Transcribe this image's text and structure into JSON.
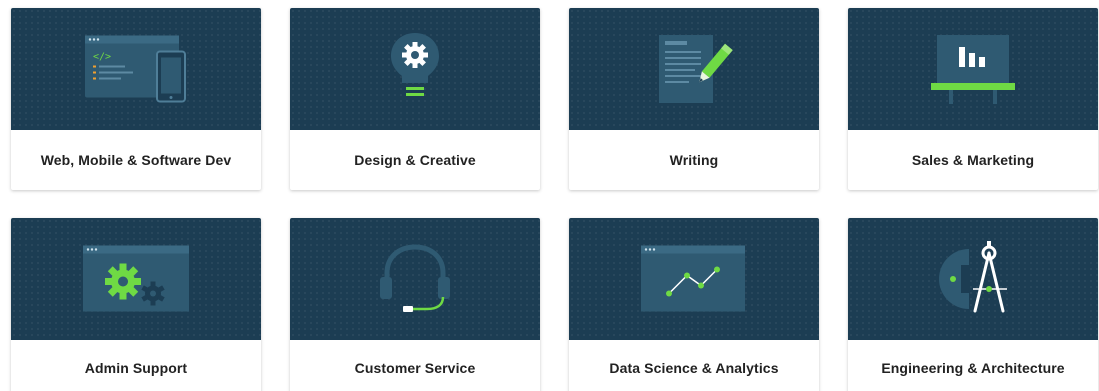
{
  "colors": {
    "hero_background": "#1c3d53",
    "icon_panel": "#2f5a72",
    "accent_green": "#6fda44"
  },
  "categories": [
    {
      "label": "Web, Mobile & Software Dev",
      "icon": "code-devices-icon"
    },
    {
      "label": "Design & Creative",
      "icon": "lightbulb-gear-icon"
    },
    {
      "label": "Writing",
      "icon": "document-pen-icon"
    },
    {
      "label": "Sales & Marketing",
      "icon": "presentation-board-icon"
    },
    {
      "label": "Admin Support",
      "icon": "gears-window-icon"
    },
    {
      "label": "Customer Service",
      "icon": "headset-icon"
    },
    {
      "label": "Data Science & Analytics",
      "icon": "line-chart-window-icon"
    },
    {
      "label": "Engineering & Architecture",
      "icon": "compass-protractor-icon"
    }
  ]
}
